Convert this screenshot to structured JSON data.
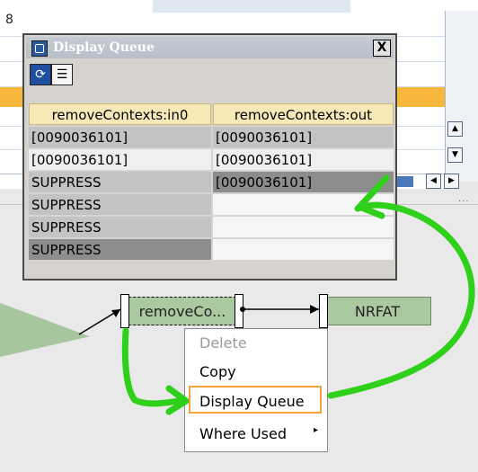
{
  "background": {
    "row_number": "8"
  },
  "display_queue": {
    "title": "Display Queue",
    "close_label": "X",
    "toolbar": {
      "refresh_icon": "refresh-icon",
      "list_icon": "list-icon"
    },
    "columns": [
      "removeContexts:in0",
      "removeContexts:out"
    ],
    "rows": [
      {
        "in0": "[0090036101]",
        "out": "[0090036101]"
      },
      {
        "in0": "[0090036101]",
        "out": "[0090036101]"
      },
      {
        "in0": "SUPPRESS",
        "out": "[0090036101]"
      },
      {
        "in0": "SUPPRESS",
        "out": ""
      },
      {
        "in0": "SUPPRESS",
        "out": ""
      },
      {
        "in0": "SUPPRESS",
        "out": ""
      }
    ]
  },
  "mapping": {
    "function_node": "removeCo...",
    "target_node": "NRFAT"
  },
  "context_menu": {
    "items": [
      "Delete",
      "Copy",
      "Display Queue",
      "Where Used"
    ],
    "highlighted": "Display Queue",
    "disabled": [
      "Delete"
    ]
  },
  "colors": {
    "annotation_green": "#2fd01a",
    "highlight_orange": "#f2a43a",
    "node_green": "#abc9a1",
    "header_yellow": "#f6e8b7"
  }
}
